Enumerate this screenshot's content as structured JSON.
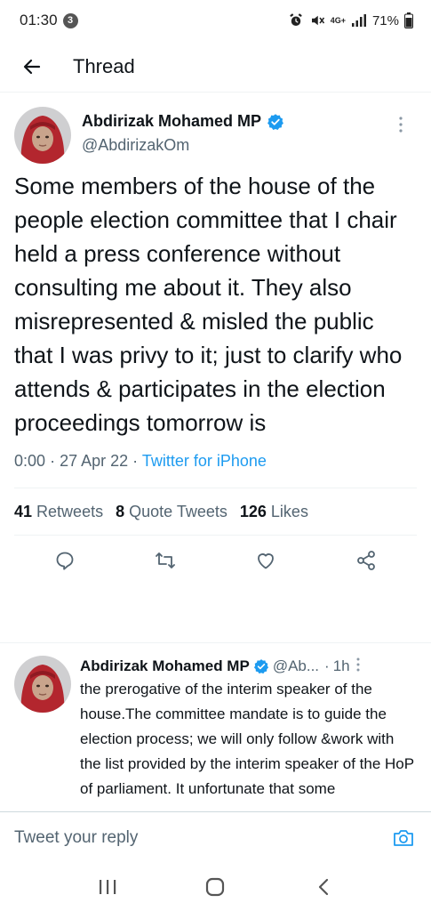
{
  "status_bar": {
    "time": "01:30",
    "notification_count": "3",
    "network_type": "4G+",
    "battery": "71%"
  },
  "header": {
    "title": "Thread"
  },
  "main_tweet": {
    "display_name": "Abdirizak Mohamed MP",
    "handle": "@AbdirizakOm",
    "text": "Some members of the house of the people election committee that I chair held a press conference without consulting me about it. They also misrepresented & misled the public that I was privy to it; just to clarify who attends & participates in the election proceedings tomorrow is",
    "time": "0:00",
    "date": "27 Apr 22",
    "source": "Twitter for iPhone",
    "retweets_count": "41",
    "retweets_label": "Retweets",
    "quotes_count": "8",
    "quotes_label": "Quote Tweets",
    "likes_count": "126",
    "likes_label": "Likes"
  },
  "reply_tweet": {
    "display_name": "Abdirizak Mohamed MP",
    "handle": "@Ab...",
    "time": "1h",
    "text": "the prerogative of the interim speaker of the house.The committee mandate is to guide the election process; we will only follow &work with the list provided by the interim speaker of the HoP of parliament. It unfortunate that some"
  },
  "compose": {
    "placeholder": "Tweet your reply"
  },
  "colors": {
    "accent": "#1d9bf0",
    "secondary_text": "#536471",
    "primary_text": "#0f1419",
    "avatar_scarf": "#b3262e"
  },
  "icons": {
    "back": "arrow-left-icon",
    "more": "more-vertical-icon",
    "verified": "verified-badge-icon",
    "reply": "reply-icon",
    "retweet": "retweet-icon",
    "like": "heart-icon",
    "share": "share-icon",
    "camera": "camera-icon"
  }
}
